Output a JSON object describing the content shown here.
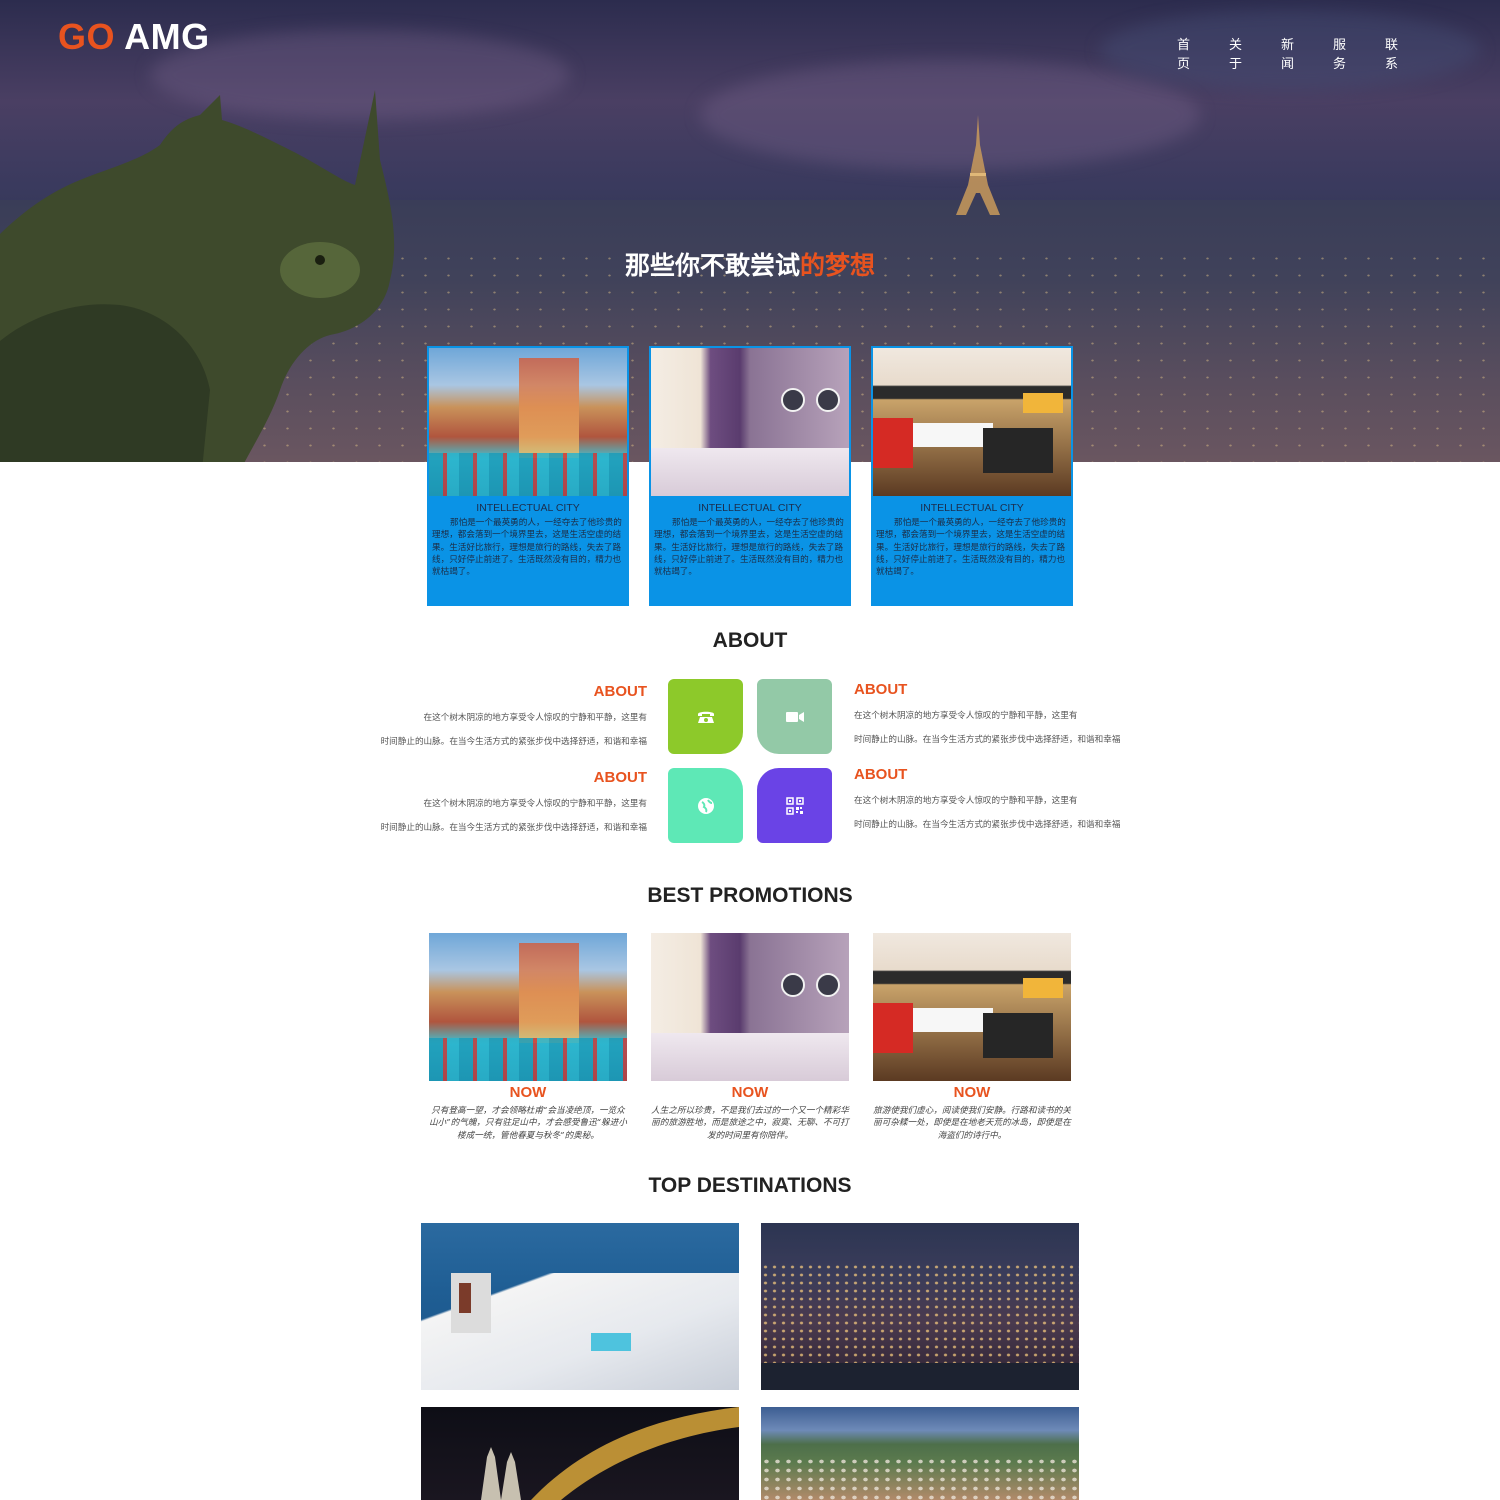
{
  "brand": {
    "go": "GO",
    "amg": " AMG"
  },
  "nav": [
    "首页",
    "关于",
    "新闻",
    "服务",
    "联系"
  ],
  "hero": {
    "title_main": "那些你不敢尝试",
    "title_accent": "的梦想"
  },
  "cards": [
    {
      "title": "INTELLECTUAL CITY",
      "text": "那怕是一个最英勇的人，一经夺去了他珍贵的理想，都会落到一个境界里去，这是生活空虚的结果。生活好比旅行，理想是旅行的路线，失去了路线，只好停止前进了。生活既然没有目的，精力也就枯竭了。",
      "image": "venice-resort"
    },
    {
      "title": "INTELLECTUAL CITY",
      "text": "那怕是一个最英勇的人，一经夺去了他珍贵的理想，都会落到一个境界里去，这是生活空虚的结果。生活好比旅行，理想是旅行的路线，失去了路线，只好停止前进了。生活既然没有目的，精力也就枯竭了。",
      "image": "hotel-room"
    },
    {
      "title": "INTELLECTUAL CITY",
      "text": "那怕是一个最英勇的人，一经夺去了他珍贵的理想，都会落到一个境界里去，这是生活空虚的结果。生活好比旅行，理想是旅行的路线，失去了路线，只好停止前进了。生活既然没有目的，精力也就枯竭了。",
      "image": "lounge"
    }
  ],
  "about": {
    "title": "ABOUT",
    "blocks": [
      {
        "heading": "ABOUT",
        "line1": "在这个树木阴凉的地方享受令人惊叹的宁静和平静，这里有",
        "line2": "时间静止的山脉。在当今生活方式的紧张步伐中选择舒适，和谐和幸福"
      },
      {
        "heading": "ABOUT",
        "line1": "在这个树木阴凉的地方享受令人惊叹的宁静和平静，这里有",
        "line2": "时间静止的山脉。在当今生活方式的紧张步伐中选择舒适，和谐和幸福"
      },
      {
        "heading": "ABOUT",
        "line1": "在这个树木阴凉的地方享受令人惊叹的宁静和平静，这里有",
        "line2": "时间静止的山脉。在当今生活方式的紧张步伐中选择舒适，和谐和幸福"
      },
      {
        "heading": "ABOUT",
        "line1": "在这个树木阴凉的地方享受令人惊叹的宁静和平静，这里有",
        "line2": "时间静止的山脉。在当今生活方式的紧张步伐中选择舒适，和谐和幸福"
      }
    ],
    "tiles": [
      {
        "icon": "phone-icon",
        "color": "#8dc92a"
      },
      {
        "icon": "video-icon",
        "color": "#93c9a7"
      },
      {
        "icon": "globe-icon",
        "color": "#5ee8b6"
      },
      {
        "icon": "qr-code-icon",
        "color": "#6a43e6"
      }
    ]
  },
  "promotions": {
    "title": "BEST PROMOTIONS",
    "items": [
      {
        "label": "NOW",
        "text": "只有登高一望，才会领略杜甫“会当凌绝顶，一览众山小”的气魄，只有驻足山中，才会感受鲁迅“躲进小楼成一统，管他春夏与秋冬”的奥秘。",
        "image": "venice-resort"
      },
      {
        "label": "NOW",
        "text": "人生之所以珍贵，不是我们去过的一个又一个精彩华丽的旅游胜地，而是旅途之中，寂寞、无聊、不可打发的时间里有你陪伴。",
        "image": "hotel-room"
      },
      {
        "label": "NOW",
        "text": "旅游使我们虚心，阅读使我们安静。行路和读书的关丽可杂糅一处，即使是在地老天荒的冰岛，即使是在海盗们的诗行中。",
        "image": "lounge"
      }
    ]
  },
  "destinations": {
    "title": "TOP DESTINATIONS",
    "items": [
      "santorini",
      "positano-night",
      "cologne-bridge",
      "coastal-village"
    ]
  },
  "colors": {
    "accent": "#e8531f",
    "card_blue": "#0a93e6",
    "white": "#ffffff"
  }
}
